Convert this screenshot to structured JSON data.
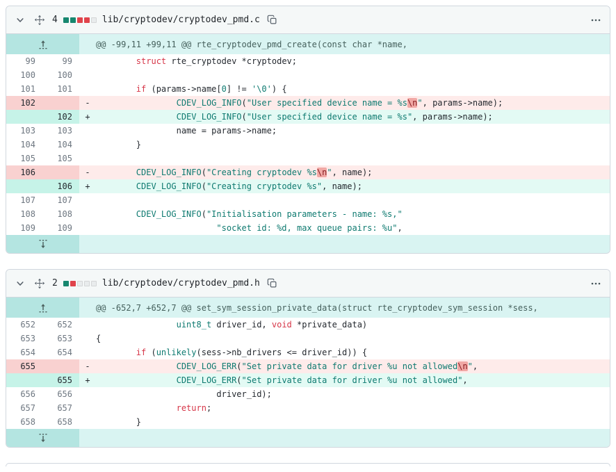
{
  "colors": {
    "border": "#d0d7de",
    "header_bg": "#f5f8f8",
    "hunk_line_bg": "#d9f4f2",
    "hunk_gutter_bg": "#b4e5e1",
    "added_line_bg": "#e3faf4",
    "added_gutter_bg": "#c6f3e8",
    "removed_line_bg": "#feebea",
    "removed_gutter_bg": "#f9d1d0",
    "word_removed_bg": "#f1a8a5",
    "keyword": "#d63648",
    "token_teal": "#0e7a70",
    "diffstat_added": "#17876f",
    "diffstat_removed": "#e0434b",
    "diffstat_neutral": "#e9eced"
  },
  "files": [
    {
      "changes_count": "4",
      "diffstat": [
        "added",
        "added",
        "removed",
        "removed",
        "neutral"
      ],
      "path": "lib/cryptodev/cryptodev_pmd.c",
      "hunk_header": "@@ -99,11 +99,11 @@ rte_cryptodev_pmd_create(const char *name,",
      "rows": [
        {
          "type": "context",
          "old": "99",
          "new": "99",
          "marker": "",
          "segments": [
            [
              "        ",
              "p"
            ],
            [
              "struct",
              "k"
            ],
            [
              " rte_cryptodev *cryptodev;",
              "p"
            ]
          ]
        },
        {
          "type": "context",
          "old": "100",
          "new": "100",
          "marker": "",
          "segments": []
        },
        {
          "type": "context",
          "old": "101",
          "new": "101",
          "marker": "",
          "segments": [
            [
              "        ",
              "p"
            ],
            [
              "if",
              "k"
            ],
            [
              " (params->name[",
              "p"
            ],
            [
              "0",
              "t"
            ],
            [
              "] != ",
              "p"
            ],
            [
              "'\\0'",
              "t"
            ],
            [
              ") {",
              "p"
            ]
          ]
        },
        {
          "type": "removed",
          "old": "102",
          "new": "",
          "marker": "-",
          "segments": [
            [
              "                ",
              "p"
            ],
            [
              "CDEV_LOG_INFO",
              "t"
            ],
            [
              "(",
              "p"
            ],
            [
              "\"User specified device name = %s",
              "t"
            ],
            [
              "\\n",
              "h"
            ],
            [
              "\"",
              "t"
            ],
            [
              ", params->name);",
              "p"
            ]
          ]
        },
        {
          "type": "added",
          "old": "",
          "new": "102",
          "marker": "+",
          "segments": [
            [
              "                ",
              "p"
            ],
            [
              "CDEV_LOG_INFO",
              "t"
            ],
            [
              "(",
              "p"
            ],
            [
              "\"User specified device name = %s\"",
              "t"
            ],
            [
              ", params->name);",
              "p"
            ]
          ]
        },
        {
          "type": "context",
          "old": "103",
          "new": "103",
          "marker": "",
          "segments": [
            [
              "                name = params->name;",
              "p"
            ]
          ]
        },
        {
          "type": "context",
          "old": "104",
          "new": "104",
          "marker": "",
          "segments": [
            [
              "        }",
              "p"
            ]
          ]
        },
        {
          "type": "context",
          "old": "105",
          "new": "105",
          "marker": "",
          "segments": []
        },
        {
          "type": "removed",
          "old": "106",
          "new": "",
          "marker": "-",
          "segments": [
            [
              "        ",
              "p"
            ],
            [
              "CDEV_LOG_INFO",
              "t"
            ],
            [
              "(",
              "p"
            ],
            [
              "\"Creating cryptodev %s",
              "t"
            ],
            [
              "\\n",
              "h"
            ],
            [
              "\"",
              "t"
            ],
            [
              ", name);",
              "p"
            ]
          ]
        },
        {
          "type": "added",
          "old": "",
          "new": "106",
          "marker": "+",
          "segments": [
            [
              "        ",
              "p"
            ],
            [
              "CDEV_LOG_INFO",
              "t"
            ],
            [
              "(",
              "p"
            ],
            [
              "\"Creating cryptodev %s\"",
              "t"
            ],
            [
              ", name);",
              "p"
            ]
          ]
        },
        {
          "type": "context",
          "old": "107",
          "new": "107",
          "marker": "",
          "segments": []
        },
        {
          "type": "context",
          "old": "108",
          "new": "108",
          "marker": "",
          "segments": [
            [
              "        ",
              "p"
            ],
            [
              "CDEV_LOG_INFO",
              "t"
            ],
            [
              "(",
              "p"
            ],
            [
              "\"Initialisation parameters - name: %s,\"",
              "t"
            ]
          ]
        },
        {
          "type": "context",
          "old": "109",
          "new": "109",
          "marker": "",
          "segments": [
            [
              "                        ",
              "p"
            ],
            [
              "\"socket id: %d, max queue pairs: %u\"",
              "t"
            ],
            [
              ",",
              "p"
            ]
          ]
        }
      ]
    },
    {
      "changes_count": "2",
      "diffstat": [
        "added",
        "removed",
        "neutral",
        "neutral",
        "neutral"
      ],
      "path": "lib/cryptodev/cryptodev_pmd.h",
      "hunk_header": "@@ -652,7 +652,7 @@ set_sym_session_private_data(struct rte_cryptodev_sym_session *sess,",
      "rows": [
        {
          "type": "context",
          "old": "652",
          "new": "652",
          "marker": "",
          "segments": [
            [
              "                ",
              "p"
            ],
            [
              "uint8_t",
              "t"
            ],
            [
              " driver_id, ",
              "p"
            ],
            [
              "void",
              "k"
            ],
            [
              " *private_data)",
              "p"
            ]
          ]
        },
        {
          "type": "context",
          "old": "653",
          "new": "653",
          "marker": "",
          "segments": [
            [
              "{",
              "p"
            ]
          ]
        },
        {
          "type": "context",
          "old": "654",
          "new": "654",
          "marker": "",
          "segments": [
            [
              "        ",
              "p"
            ],
            [
              "if",
              "k"
            ],
            [
              " (",
              "p"
            ],
            [
              "unlikely",
              "t"
            ],
            [
              "(sess->nb_drivers <= driver_id)) {",
              "p"
            ]
          ]
        },
        {
          "type": "removed",
          "old": "655",
          "new": "",
          "marker": "-",
          "segments": [
            [
              "                ",
              "p"
            ],
            [
              "CDEV_LOG_ERR",
              "t"
            ],
            [
              "(",
              "p"
            ],
            [
              "\"Set private data for driver %u not allowed",
              "t"
            ],
            [
              "\\n",
              "h"
            ],
            [
              "\"",
              "t"
            ],
            [
              ",",
              "p"
            ]
          ]
        },
        {
          "type": "added",
          "old": "",
          "new": "655",
          "marker": "+",
          "segments": [
            [
              "                ",
              "p"
            ],
            [
              "CDEV_LOG_ERR",
              "t"
            ],
            [
              "(",
              "p"
            ],
            [
              "\"Set private data for driver %u not allowed\"",
              "t"
            ],
            [
              ",",
              "p"
            ]
          ]
        },
        {
          "type": "context",
          "old": "656",
          "new": "656",
          "marker": "",
          "segments": [
            [
              "                        driver_id);",
              "p"
            ]
          ]
        },
        {
          "type": "context",
          "old": "657",
          "new": "657",
          "marker": "",
          "segments": [
            [
              "                ",
              "p"
            ],
            [
              "return",
              "k"
            ],
            [
              ";",
              "p"
            ]
          ]
        },
        {
          "type": "context",
          "old": "658",
          "new": "658",
          "marker": "",
          "segments": [
            [
              "        }",
              "p"
            ]
          ]
        }
      ]
    }
  ]
}
